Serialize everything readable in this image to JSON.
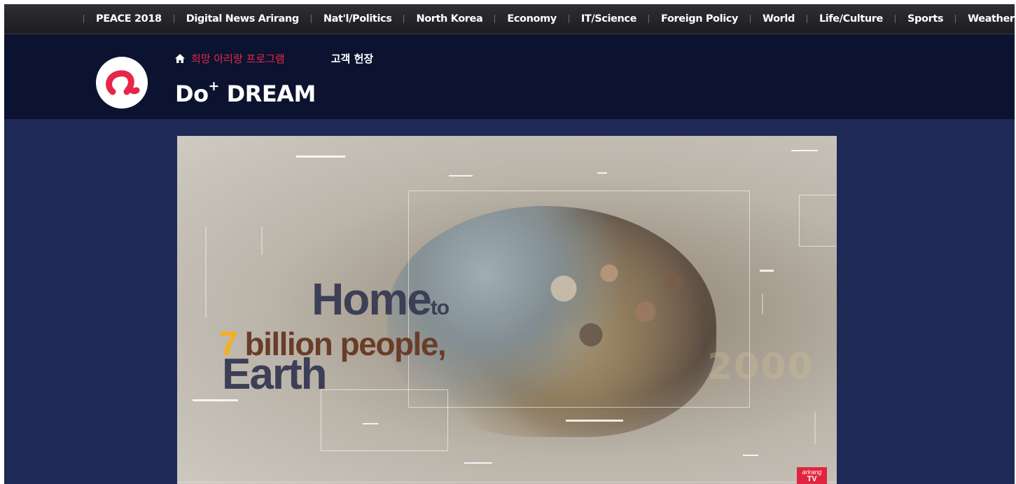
{
  "topnav": {
    "items": [
      "PEACE 2018",
      "Digital News Arirang",
      "Nat'l/Politics",
      "North Korea",
      "Economy",
      "IT/Science",
      "Foreign Policy",
      "World",
      "Life/Culture",
      "Sports",
      "Weather"
    ]
  },
  "header": {
    "logo_icon": "arirang-a-logo",
    "home_icon": "home-icon",
    "breadcrumb_current": "희망 아리랑 프로그램",
    "breadcrumb_next": "고객 헌장",
    "show_title_main": "Do",
    "show_title_sup": "+",
    "show_title_rest": " DREAM",
    "accent_color": "#e8264a",
    "header_bg": "#0b1330",
    "page_bg": "#1e2a55"
  },
  "video": {
    "headline_line1": "Home",
    "headline_line1_small": "to",
    "headline_line2_num": "7",
    "headline_line2_rest": " billion people,",
    "headline_line3": "Earth",
    "year": "2000",
    "badge_brand": "arirang",
    "badge_tv": "TV"
  }
}
